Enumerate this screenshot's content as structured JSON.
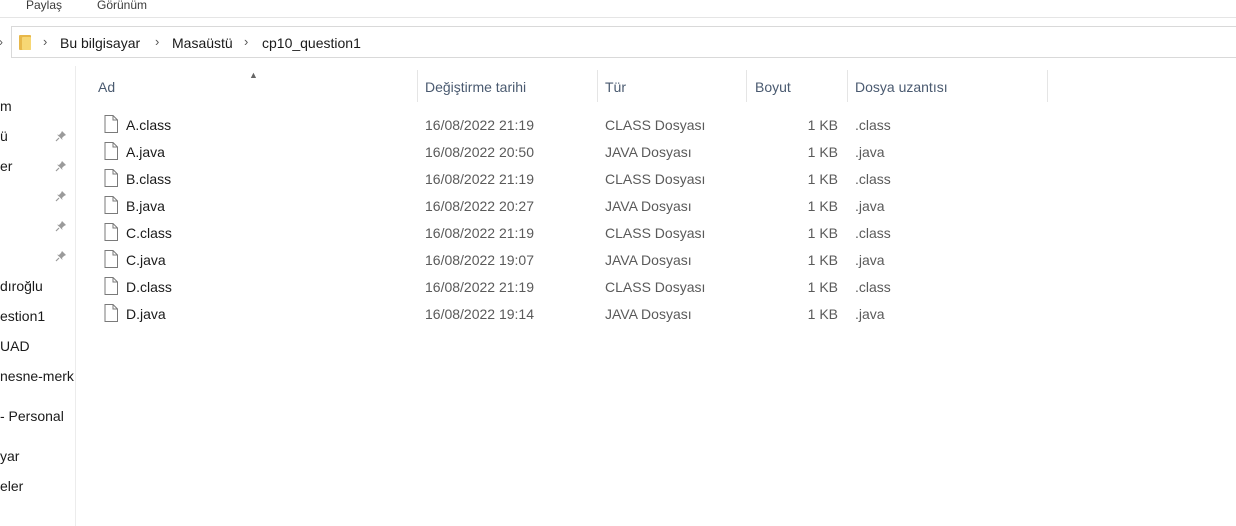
{
  "ribbon": {
    "tabs": [
      "Paylaş",
      "Görünüm"
    ]
  },
  "address": {
    "breadcrumbs": [
      "Bu bilgisayar",
      "Masaüstü",
      "cp10_question1"
    ]
  },
  "nav": {
    "items": [
      {
        "label": "m",
        "pinned": false
      },
      {
        "label": "ü",
        "pinned": true
      },
      {
        "label": "er",
        "pinned": true
      },
      {
        "label": "",
        "pinned": true
      },
      {
        "label": "",
        "pinned": true
      },
      {
        "label": "",
        "pinned": true
      },
      {
        "label": "dıroğlu",
        "pinned": false
      },
      {
        "label": "estion1",
        "pinned": false
      },
      {
        "label": "UAD",
        "pinned": false
      },
      {
        "label": "nesne-merk",
        "pinned": false
      },
      {
        "label": "- Personal",
        "pinned": false
      },
      {
        "label": "yar",
        "pinned": false
      },
      {
        "label": "eler",
        "pinned": false
      }
    ]
  },
  "columns": {
    "name": "Ad",
    "date": "Değiştirme tarihi",
    "type": "Tür",
    "size": "Boyut",
    "ext": "Dosya uzantısı"
  },
  "files": [
    {
      "name": "A.class",
      "date": "16/08/2022 21:19",
      "type": "CLASS Dosyası",
      "size": "1 KB",
      "ext": ".class"
    },
    {
      "name": "A.java",
      "date": "16/08/2022 20:50",
      "type": "JAVA Dosyası",
      "size": "1 KB",
      "ext": ".java"
    },
    {
      "name": "B.class",
      "date": "16/08/2022 21:19",
      "type": "CLASS Dosyası",
      "size": "1 KB",
      "ext": ".class"
    },
    {
      "name": "B.java",
      "date": "16/08/2022 20:27",
      "type": "JAVA Dosyası",
      "size": "1 KB",
      "ext": ".java"
    },
    {
      "name": "C.class",
      "date": "16/08/2022 21:19",
      "type": "CLASS Dosyası",
      "size": "1 KB",
      "ext": ".class"
    },
    {
      "name": "C.java",
      "date": "16/08/2022 19:07",
      "type": "JAVA Dosyası",
      "size": "1 KB",
      "ext": ".java"
    },
    {
      "name": "D.class",
      "date": "16/08/2022 21:19",
      "type": "CLASS Dosyası",
      "size": "1 KB",
      "ext": ".class"
    },
    {
      "name": "D.java",
      "date": "16/08/2022 19:14",
      "type": "JAVA Dosyası",
      "size": "1 KB",
      "ext": ".java"
    }
  ],
  "icons": {
    "folder": "folder-icon",
    "file": "file-icon",
    "pin": "pin-icon",
    "chevron": "chevron-right-icon",
    "sort": "sort-up-icon"
  },
  "colors": {
    "header_text": "#4a5a70",
    "secondary_text": "#5a5a5a",
    "folder": "#f7d774"
  }
}
